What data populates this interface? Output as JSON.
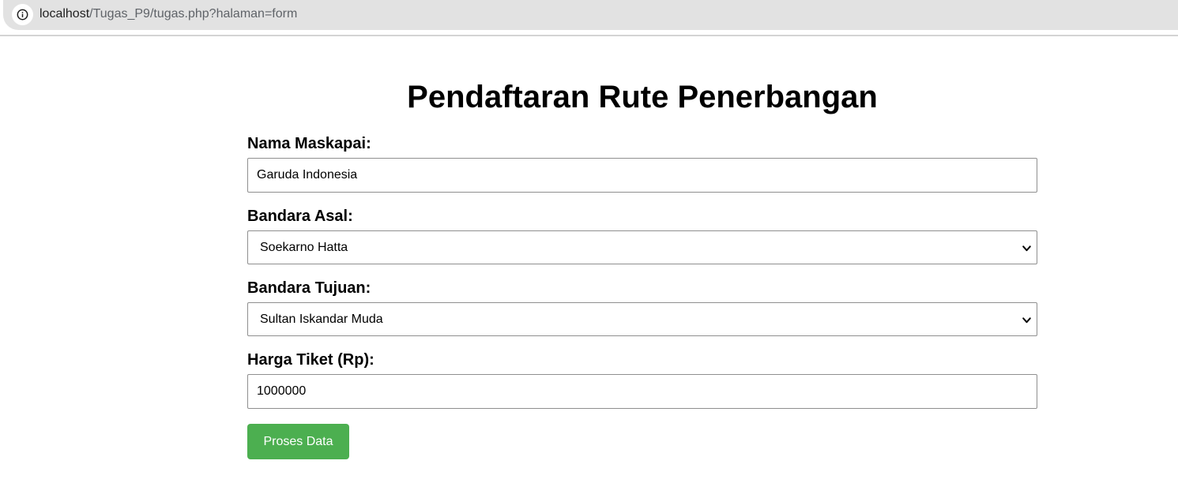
{
  "browser": {
    "url_host": "localhost",
    "url_path": "/Tugas_P9/tugas.php?halaman=form"
  },
  "form": {
    "title": "Pendaftaran Rute Penerbangan",
    "maskapai_label": "Nama Maskapai:",
    "maskapai_value": "Garuda Indonesia",
    "asal_label": "Bandara Asal:",
    "asal_value": "Soekarno Hatta",
    "tujuan_label": "Bandara Tujuan:",
    "tujuan_value": "Sultan Iskandar Muda",
    "harga_label": "Harga Tiket (Rp):",
    "harga_value": "1000000",
    "submit_label": "Proses Data"
  },
  "colors": {
    "button": "#4caf50",
    "button_text": "#ffffff"
  },
  "icons": {
    "site_info": "info-icon",
    "select_arrow": "chevron-down-icon"
  }
}
